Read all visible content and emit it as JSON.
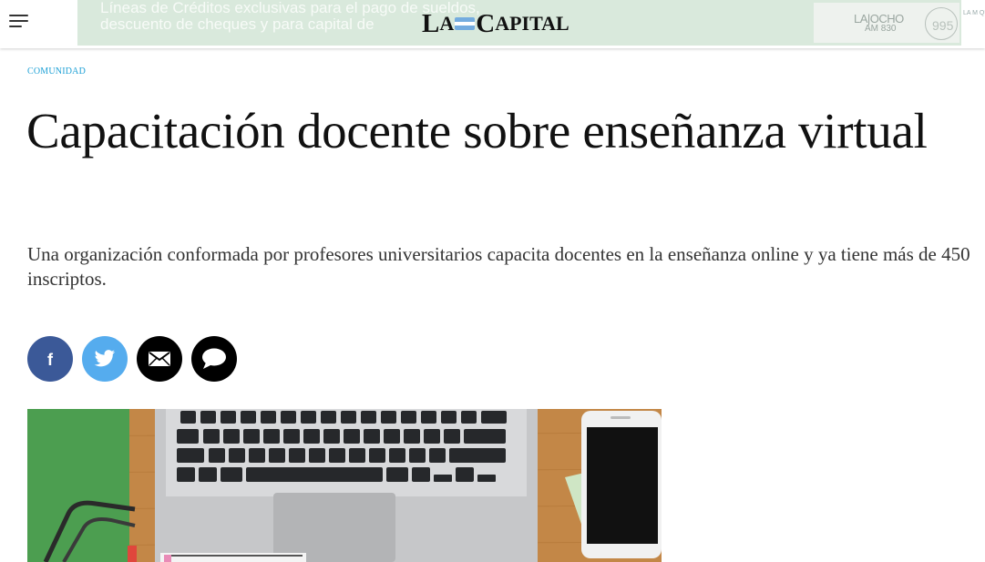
{
  "header": {
    "menu_icon": "hamburger-icon",
    "logo_prefix": "La",
    "logo_suffix": "Capital"
  },
  "ad": {
    "line1": "Líneas de Créditos exclusivas para el pago de sueldos,",
    "line2": "descuento de cheques y para capital de",
    "radio1": "LA|OCHO",
    "radio1_sub": "AM 830",
    "radio2": "995",
    "tail": "LA M QUE ESCU"
  },
  "article": {
    "section": "COMUNIDAD",
    "title": "Capacitación docente sobre enseñanza virtual",
    "summary": "Una organización conformada por profesores universitarios capacita docentes en la enseñanza online y ya tiene más de 450 inscriptos."
  },
  "share": {
    "facebook_icon": "facebook-icon",
    "twitter_icon": "twitter-icon",
    "email_icon": "mail-icon",
    "comment_icon": "comment-icon"
  },
  "colors": {
    "section": "#1fa1d6",
    "facebook": "#3b5998",
    "twitter": "#55acee",
    "ad_bg": "#d9e9dc"
  }
}
